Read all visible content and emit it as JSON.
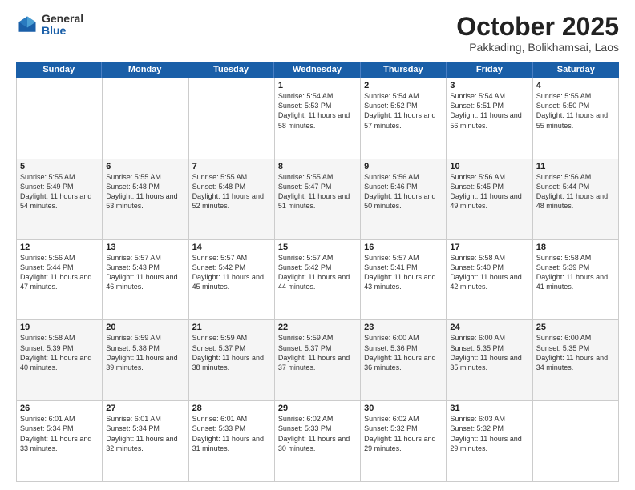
{
  "logo": {
    "general": "General",
    "blue": "Blue"
  },
  "header": {
    "month": "October 2025",
    "location": "Pakkading, Bolikhamsai, Laos"
  },
  "weekdays": [
    "Sunday",
    "Monday",
    "Tuesday",
    "Wednesday",
    "Thursday",
    "Friday",
    "Saturday"
  ],
  "rows": [
    [
      {
        "day": "",
        "sunrise": "",
        "sunset": "",
        "daylight": ""
      },
      {
        "day": "",
        "sunrise": "",
        "sunset": "",
        "daylight": ""
      },
      {
        "day": "",
        "sunrise": "",
        "sunset": "",
        "daylight": ""
      },
      {
        "day": "1",
        "sunrise": "Sunrise: 5:54 AM",
        "sunset": "Sunset: 5:53 PM",
        "daylight": "Daylight: 11 hours and 58 minutes."
      },
      {
        "day": "2",
        "sunrise": "Sunrise: 5:54 AM",
        "sunset": "Sunset: 5:52 PM",
        "daylight": "Daylight: 11 hours and 57 minutes."
      },
      {
        "day": "3",
        "sunrise": "Sunrise: 5:54 AM",
        "sunset": "Sunset: 5:51 PM",
        "daylight": "Daylight: 11 hours and 56 minutes."
      },
      {
        "day": "4",
        "sunrise": "Sunrise: 5:55 AM",
        "sunset": "Sunset: 5:50 PM",
        "daylight": "Daylight: 11 hours and 55 minutes."
      }
    ],
    [
      {
        "day": "5",
        "sunrise": "Sunrise: 5:55 AM",
        "sunset": "Sunset: 5:49 PM",
        "daylight": "Daylight: 11 hours and 54 minutes."
      },
      {
        "day": "6",
        "sunrise": "Sunrise: 5:55 AM",
        "sunset": "Sunset: 5:48 PM",
        "daylight": "Daylight: 11 hours and 53 minutes."
      },
      {
        "day": "7",
        "sunrise": "Sunrise: 5:55 AM",
        "sunset": "Sunset: 5:48 PM",
        "daylight": "Daylight: 11 hours and 52 minutes."
      },
      {
        "day": "8",
        "sunrise": "Sunrise: 5:55 AM",
        "sunset": "Sunset: 5:47 PM",
        "daylight": "Daylight: 11 hours and 51 minutes."
      },
      {
        "day": "9",
        "sunrise": "Sunrise: 5:56 AM",
        "sunset": "Sunset: 5:46 PM",
        "daylight": "Daylight: 11 hours and 50 minutes."
      },
      {
        "day": "10",
        "sunrise": "Sunrise: 5:56 AM",
        "sunset": "Sunset: 5:45 PM",
        "daylight": "Daylight: 11 hours and 49 minutes."
      },
      {
        "day": "11",
        "sunrise": "Sunrise: 5:56 AM",
        "sunset": "Sunset: 5:44 PM",
        "daylight": "Daylight: 11 hours and 48 minutes."
      }
    ],
    [
      {
        "day": "12",
        "sunrise": "Sunrise: 5:56 AM",
        "sunset": "Sunset: 5:44 PM",
        "daylight": "Daylight: 11 hours and 47 minutes."
      },
      {
        "day": "13",
        "sunrise": "Sunrise: 5:57 AM",
        "sunset": "Sunset: 5:43 PM",
        "daylight": "Daylight: 11 hours and 46 minutes."
      },
      {
        "day": "14",
        "sunrise": "Sunrise: 5:57 AM",
        "sunset": "Sunset: 5:42 PM",
        "daylight": "Daylight: 11 hours and 45 minutes."
      },
      {
        "day": "15",
        "sunrise": "Sunrise: 5:57 AM",
        "sunset": "Sunset: 5:42 PM",
        "daylight": "Daylight: 11 hours and 44 minutes."
      },
      {
        "day": "16",
        "sunrise": "Sunrise: 5:57 AM",
        "sunset": "Sunset: 5:41 PM",
        "daylight": "Daylight: 11 hours and 43 minutes."
      },
      {
        "day": "17",
        "sunrise": "Sunrise: 5:58 AM",
        "sunset": "Sunset: 5:40 PM",
        "daylight": "Daylight: 11 hours and 42 minutes."
      },
      {
        "day": "18",
        "sunrise": "Sunrise: 5:58 AM",
        "sunset": "Sunset: 5:39 PM",
        "daylight": "Daylight: 11 hours and 41 minutes."
      }
    ],
    [
      {
        "day": "19",
        "sunrise": "Sunrise: 5:58 AM",
        "sunset": "Sunset: 5:39 PM",
        "daylight": "Daylight: 11 hours and 40 minutes."
      },
      {
        "day": "20",
        "sunrise": "Sunrise: 5:59 AM",
        "sunset": "Sunset: 5:38 PM",
        "daylight": "Daylight: 11 hours and 39 minutes."
      },
      {
        "day": "21",
        "sunrise": "Sunrise: 5:59 AM",
        "sunset": "Sunset: 5:37 PM",
        "daylight": "Daylight: 11 hours and 38 minutes."
      },
      {
        "day": "22",
        "sunrise": "Sunrise: 5:59 AM",
        "sunset": "Sunset: 5:37 PM",
        "daylight": "Daylight: 11 hours and 37 minutes."
      },
      {
        "day": "23",
        "sunrise": "Sunrise: 6:00 AM",
        "sunset": "Sunset: 5:36 PM",
        "daylight": "Daylight: 11 hours and 36 minutes."
      },
      {
        "day": "24",
        "sunrise": "Sunrise: 6:00 AM",
        "sunset": "Sunset: 5:35 PM",
        "daylight": "Daylight: 11 hours and 35 minutes."
      },
      {
        "day": "25",
        "sunrise": "Sunrise: 6:00 AM",
        "sunset": "Sunset: 5:35 PM",
        "daylight": "Daylight: 11 hours and 34 minutes."
      }
    ],
    [
      {
        "day": "26",
        "sunrise": "Sunrise: 6:01 AM",
        "sunset": "Sunset: 5:34 PM",
        "daylight": "Daylight: 11 hours and 33 minutes."
      },
      {
        "day": "27",
        "sunrise": "Sunrise: 6:01 AM",
        "sunset": "Sunset: 5:34 PM",
        "daylight": "Daylight: 11 hours and 32 minutes."
      },
      {
        "day": "28",
        "sunrise": "Sunrise: 6:01 AM",
        "sunset": "Sunset: 5:33 PM",
        "daylight": "Daylight: 11 hours and 31 minutes."
      },
      {
        "day": "29",
        "sunrise": "Sunrise: 6:02 AM",
        "sunset": "Sunset: 5:33 PM",
        "daylight": "Daylight: 11 hours and 30 minutes."
      },
      {
        "day": "30",
        "sunrise": "Sunrise: 6:02 AM",
        "sunset": "Sunset: 5:32 PM",
        "daylight": "Daylight: 11 hours and 29 minutes."
      },
      {
        "day": "31",
        "sunrise": "Sunrise: 6:03 AM",
        "sunset": "Sunset: 5:32 PM",
        "daylight": "Daylight: 11 hours and 29 minutes."
      },
      {
        "day": "",
        "sunrise": "",
        "sunset": "",
        "daylight": ""
      }
    ]
  ]
}
